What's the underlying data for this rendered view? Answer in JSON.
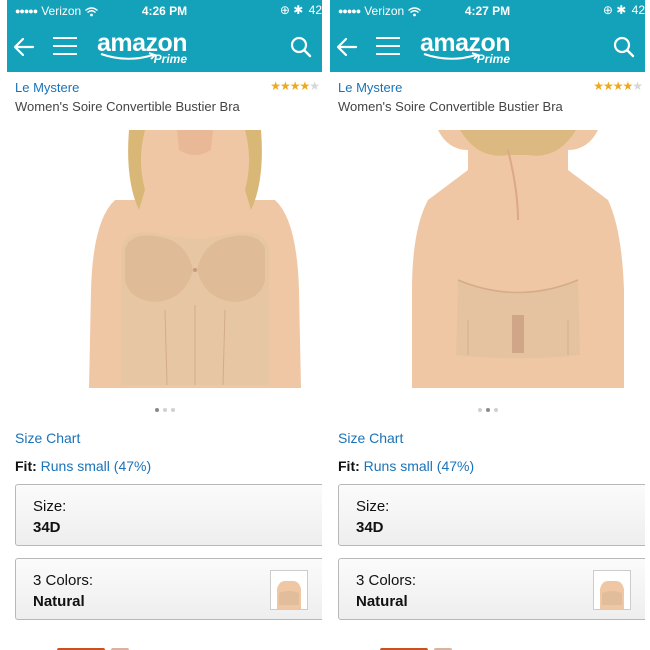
{
  "screens": [
    {
      "status": {
        "carrier": "Verizon",
        "time": "4:26 PM",
        "battery": "42"
      },
      "nav": {
        "logo": "amazon",
        "logo_sub": "Prime"
      },
      "product": {
        "brand": "Le Mystere",
        "rating": 3.5,
        "title": "Women's Soire Convertible Bustier Bra",
        "image": "front-view",
        "carousel_active": 0
      },
      "size_chart": "Size Chart",
      "fit": {
        "label": "Fit:",
        "value": "Runs small (47%)"
      },
      "size": {
        "label": "Size:",
        "value": "34D"
      },
      "colors": {
        "label": "3 Colors:",
        "value": "Natural"
      }
    },
    {
      "status": {
        "carrier": "Verizon",
        "time": "4:27 PM",
        "battery": "42"
      },
      "nav": {
        "logo": "amazon",
        "logo_sub": "Prime"
      },
      "product": {
        "brand": "Le Mystere",
        "rating": 3.5,
        "title": "Women's Soire Convertible Bustier Bra",
        "image": "back-view",
        "carousel_active": 1
      },
      "size_chart": "Size Chart",
      "fit": {
        "label": "Fit:",
        "value": "Runs small (47%)"
      },
      "size": {
        "label": "Size:",
        "value": "34D"
      },
      "colors": {
        "label": "3 Colors:",
        "value": "Natural"
      }
    }
  ],
  "colors": {
    "header": "#13a2b9",
    "link": "#1a73b8",
    "star": "#f0a81a"
  }
}
